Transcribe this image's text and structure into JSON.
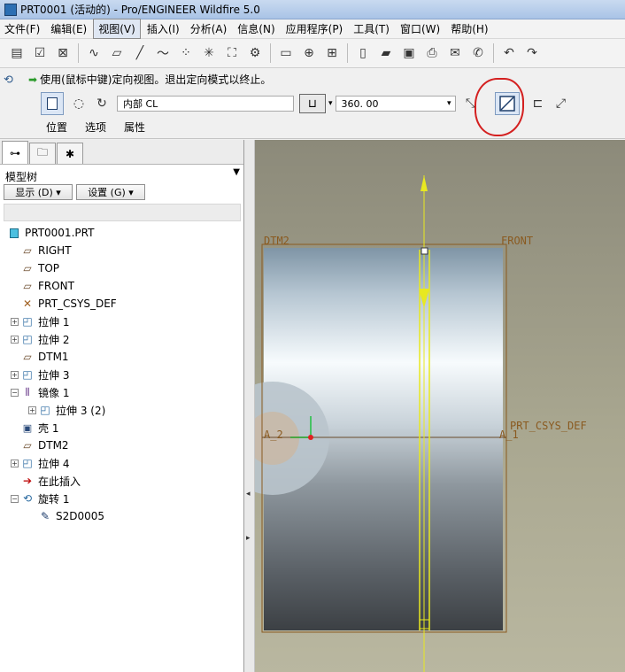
{
  "window": {
    "title": "PRT0001 (活动的) - Pro/ENGINEER Wildfire 5.0"
  },
  "menubar": {
    "items": [
      "文件(F)",
      "编辑(E)",
      "视图(V)",
      "插入(I)",
      "分析(A)",
      "信息(N)",
      "应用程序(P)",
      "工具(T)",
      "窗口(W)",
      "帮助(H)"
    ],
    "active_index": 2
  },
  "dashboard": {
    "message": "使用(鼠标中键)定向视图。退出定向模式以终止。",
    "reference_field": "内部 CL",
    "angle_value": "360. 00",
    "tabs": [
      "位置",
      "选项",
      "属性"
    ]
  },
  "model_tree": {
    "label": "模型树",
    "show_button": "显示 (D) ▾",
    "settings_button": "设置 (G) ▾",
    "root": "PRT0001.PRT",
    "items": [
      {
        "label": "RIGHT",
        "icon": "datum-plane-icon",
        "expandable": false,
        "indent": 1
      },
      {
        "label": "TOP",
        "icon": "datum-plane-icon",
        "expandable": false,
        "indent": 1
      },
      {
        "label": "FRONT",
        "icon": "datum-plane-icon",
        "expandable": false,
        "indent": 1
      },
      {
        "label": "PRT_CSYS_DEF",
        "icon": "csys-icon",
        "expandable": false,
        "indent": 1
      },
      {
        "label": "拉伸 1",
        "icon": "extrude-icon",
        "expandable": true,
        "expanded": false,
        "indent": 1
      },
      {
        "label": "拉伸 2",
        "icon": "extrude-icon",
        "expandable": true,
        "expanded": false,
        "indent": 1
      },
      {
        "label": "DTM1",
        "icon": "datum-plane-icon",
        "expandable": false,
        "indent": 1
      },
      {
        "label": "拉伸 3",
        "icon": "extrude-icon",
        "expandable": true,
        "expanded": false,
        "indent": 1
      },
      {
        "label": "镜像 1",
        "icon": "mirror-icon",
        "expandable": true,
        "expanded": true,
        "indent": 1
      },
      {
        "label": "拉伸 3 (2)",
        "icon": "extrude-icon",
        "expandable": true,
        "expanded": false,
        "indent": 2
      },
      {
        "label": "壳 1",
        "icon": "shell-icon",
        "expandable": false,
        "indent": 1
      },
      {
        "label": "DTM2",
        "icon": "datum-plane-icon",
        "expandable": false,
        "indent": 1
      },
      {
        "label": "拉伸 4",
        "icon": "extrude-icon",
        "expandable": true,
        "expanded": false,
        "indent": 1
      },
      {
        "label": "在此插入",
        "icon": "insert-arrow-icon",
        "expandable": false,
        "indent": 1
      },
      {
        "label": "旋转 1",
        "icon": "revolve-icon",
        "expandable": true,
        "expanded": true,
        "indent": 1
      },
      {
        "label": "S2D0005",
        "icon": "sketch-icon",
        "expandable": false,
        "indent": 2
      }
    ]
  },
  "graphics": {
    "labels": {
      "dtm2": "DTM2",
      "front": "FRONT",
      "csys": "PRT_CSYS_DEF",
      "axis_left": "A_2",
      "axis_right": "A_1"
    }
  },
  "colors": {
    "datum": "#8a5a20",
    "accent": "#d42020",
    "sketch": "#e8e820"
  }
}
